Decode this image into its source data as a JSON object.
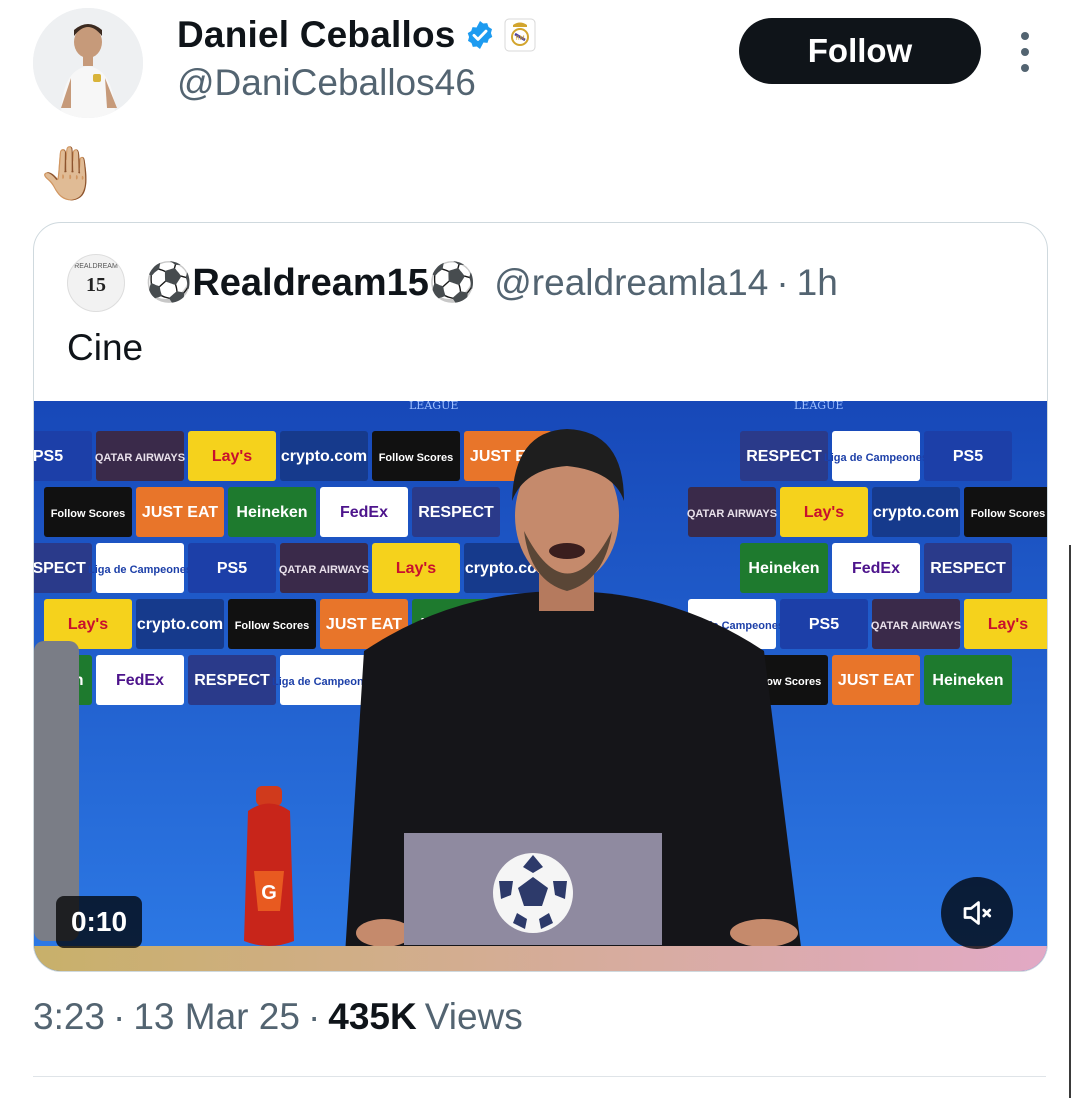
{
  "author": {
    "name": "Daniel Ceballos",
    "handle": "@DaniCeballos46",
    "verified_color": "#1d9bf0"
  },
  "follow_label": "Follow",
  "tweet_text": "🤚🏼",
  "quote": {
    "avatar_number": "15",
    "avatar_caption": "REALDREAM",
    "name": "⚽Realdream15⚽",
    "handle": "@realdreamla14",
    "separator": "·",
    "age": "1h",
    "text": "Cine",
    "video": {
      "duration": "0:10",
      "sponsor_boards": [
        "PS5",
        "QATAR AIRWAYS",
        "Lay's",
        "crypto.com",
        "Follow Scores",
        "JUST EAT",
        "Heineken",
        "FedEx",
        "RESPECT",
        "Liga de Campeones"
      ],
      "backdrop_header": "LEAGUE"
    }
  },
  "meta": {
    "time": "3:23",
    "sep1": "·",
    "date": "13 Mar 25",
    "sep2": "·",
    "views_count": "435K",
    "views_label": "Views"
  }
}
